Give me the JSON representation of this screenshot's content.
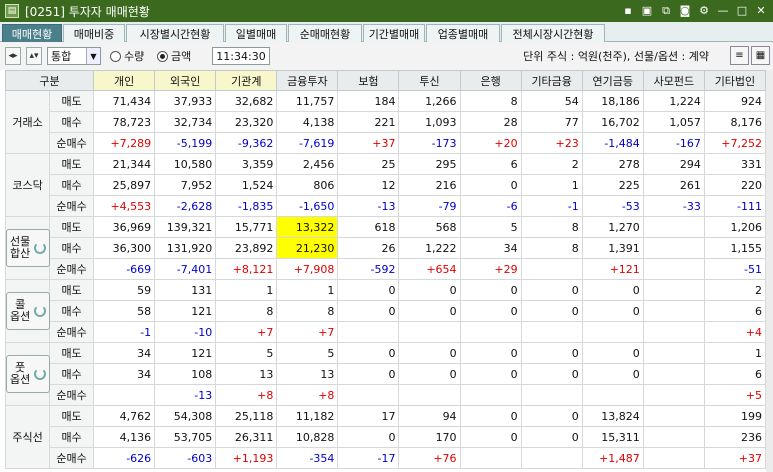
{
  "window": {
    "title": "[0251] 투자자 매매현황",
    "icons": [
      "pin-icon",
      "window-icon",
      "copy-icon",
      "camera-icon",
      "gear-icon",
      "minimize-icon",
      "maximize-icon",
      "close-icon"
    ]
  },
  "tabs": [
    "매매현황",
    "매매비중",
    "시장별시간현황",
    "일별매매",
    "순매매현황",
    "기간별매매",
    "업종별매매",
    "전체시장시간현황"
  ],
  "toolbar": {
    "market": "통합",
    "radio_qty": "수량",
    "radio_amt": "금액",
    "selected": "금액",
    "time": "11:34:30",
    "unit": "단위 주식 : 억원(천주), 선물/옵션 : 계약"
  },
  "headers": [
    "구분",
    "개인",
    "외국인",
    "기관계",
    "금융투자",
    "보험",
    "투신",
    "은행",
    "기타금융",
    "연기금등",
    "사모펀드",
    "기타법인"
  ],
  "sub_labels": [
    "매도",
    "매수",
    "순매수"
  ],
  "groups": [
    {
      "label": "거래소",
      "rows": [
        [
          "71,434",
          "37,933",
          "32,682",
          "11,757",
          "184",
          "1,266",
          "8",
          "54",
          "18,186",
          "1,224",
          "924"
        ],
        [
          "78,723",
          "32,734",
          "23,320",
          "4,138",
          "221",
          "1,093",
          "28",
          "77",
          "16,702",
          "1,057",
          "8,176"
        ],
        [
          "+7,289",
          "-5,199",
          "-9,362",
          "-7,619",
          "+37",
          "-173",
          "+20",
          "+23",
          "-1,484",
          "-167",
          "+7,252"
        ]
      ]
    },
    {
      "label": "코스닥",
      "rows": [
        [
          "21,344",
          "10,580",
          "3,359",
          "2,456",
          "25",
          "295",
          "6",
          "2",
          "278",
          "294",
          "331"
        ],
        [
          "25,897",
          "7,952",
          "1,524",
          "806",
          "12",
          "216",
          "0",
          "1",
          "225",
          "261",
          "220"
        ],
        [
          "+4,553",
          "-2,628",
          "-1,835",
          "-1,650",
          "-13",
          "-79",
          "-6",
          "-1",
          "-53",
          "-33",
          "-111"
        ]
      ]
    },
    {
      "label": "선물\n합산",
      "button": true,
      "rows": [
        [
          "36,969",
          "139,321",
          "15,771",
          "13,322",
          "618",
          "568",
          "5",
          "8",
          "1,270",
          "",
          "1,206"
        ],
        [
          "36,300",
          "131,920",
          "23,892",
          "21,230",
          "26",
          "1,222",
          "34",
          "8",
          "1,391",
          "",
          "1,155"
        ],
        [
          "-669",
          "-7,401",
          "+8,121",
          "+7,908",
          "-592",
          "+654",
          "+29",
          "",
          "+121",
          "",
          "-51"
        ]
      ]
    },
    {
      "label": "콜\n옵션",
      "button": true,
      "rows": [
        [
          "59",
          "131",
          "1",
          "1",
          "0",
          "0",
          "0",
          "0",
          "0",
          "",
          "2"
        ],
        [
          "58",
          "121",
          "8",
          "8",
          "0",
          "0",
          "0",
          "0",
          "0",
          "",
          "6"
        ],
        [
          "-1",
          "-10",
          "+7",
          "+7",
          "",
          "",
          "",
          "",
          "",
          "",
          "+4"
        ]
      ]
    },
    {
      "label": "풋\n옵션",
      "button": true,
      "rows": [
        [
          "34",
          "121",
          "5",
          "5",
          "0",
          "0",
          "0",
          "0",
          "0",
          "",
          "1"
        ],
        [
          "34",
          "108",
          "13",
          "13",
          "0",
          "0",
          "0",
          "0",
          "0",
          "",
          "6"
        ],
        [
          "",
          "-13",
          "+8",
          "+8",
          "",
          "",
          "",
          "",
          "",
          "",
          "+5"
        ]
      ]
    },
    {
      "label": "주식선",
      "rows": [
        [
          "4,762",
          "54,308",
          "25,118",
          "11,182",
          "17",
          "94",
          "0",
          "0",
          "13,824",
          "",
          "199"
        ],
        [
          "4,136",
          "53,705",
          "26,311",
          "10,828",
          "0",
          "170",
          "0",
          "0",
          "15,311",
          "",
          "236"
        ],
        [
          "-626",
          "-603",
          "+1,193",
          "-354",
          "-17",
          "+76",
          "",
          "",
          "+1,487",
          "",
          "+37"
        ]
      ]
    }
  ],
  "highlight_cells": [
    [
      2,
      0,
      3
    ],
    [
      2,
      1,
      3
    ]
  ],
  "highlight_color": "#ffff00",
  "colors": {
    "positive": "#e00000",
    "negative": "#0000c8",
    "title_bar": "#3b6a1f",
    "active_tab": "#4b7f8c"
  }
}
